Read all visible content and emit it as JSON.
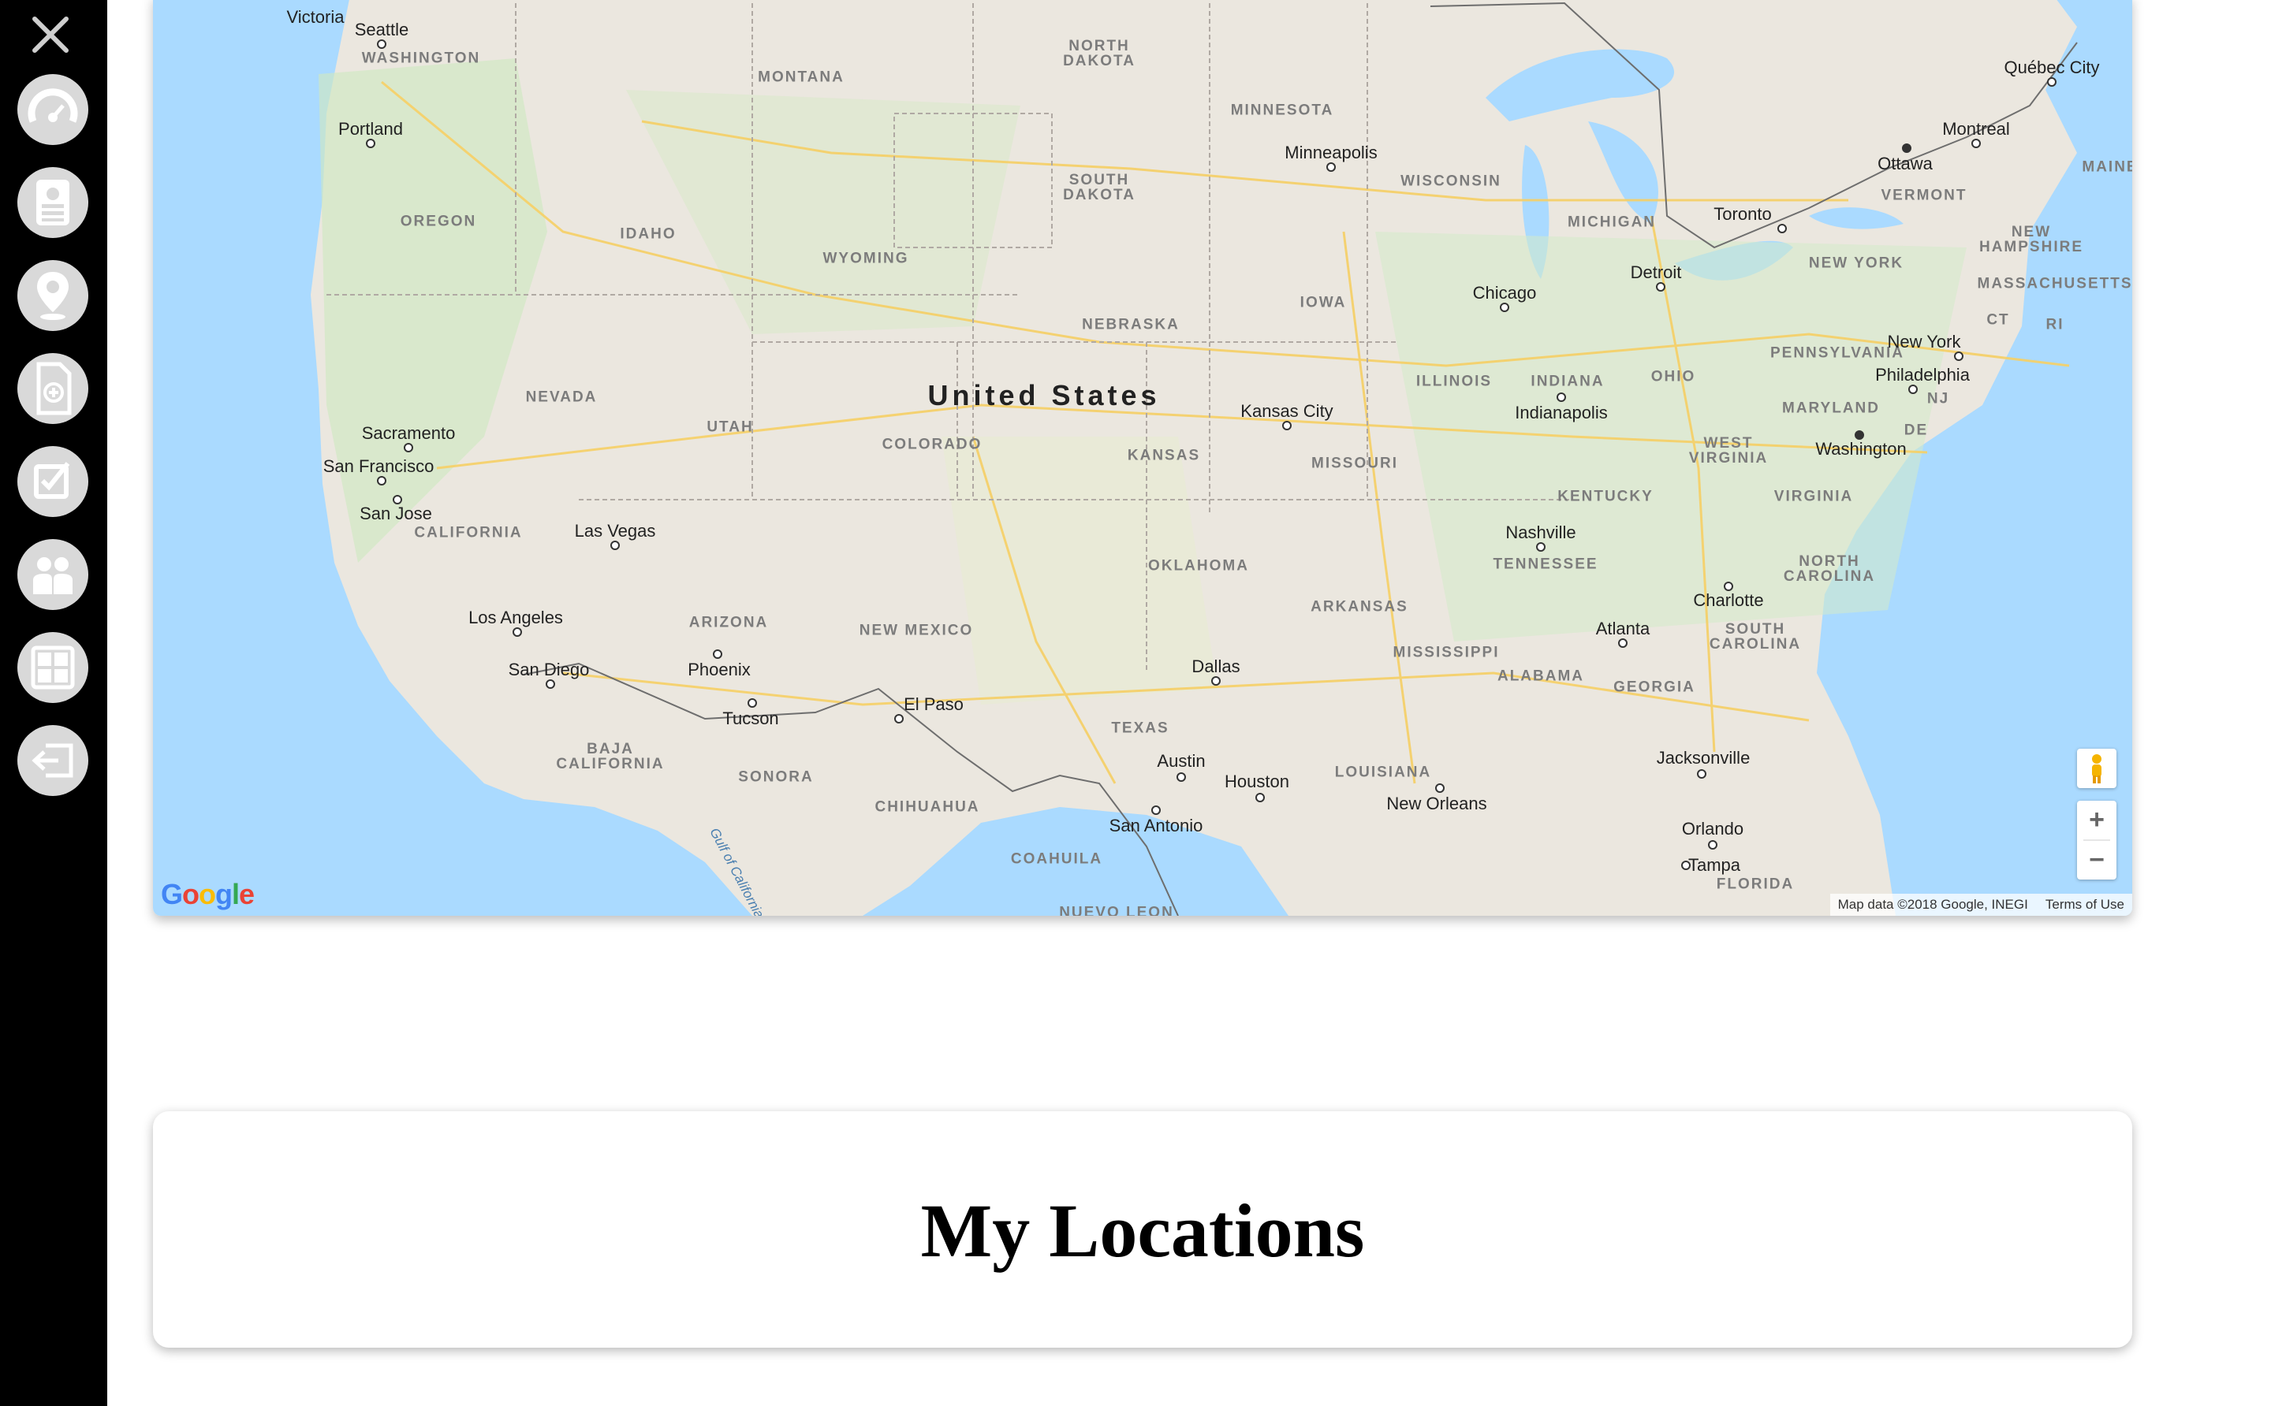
{
  "sidebar": {
    "close_icon": "close-icon",
    "items": [
      {
        "name": "dashboard",
        "icon": "speedometer-icon"
      },
      {
        "name": "profile",
        "icon": "id-card-icon"
      },
      {
        "name": "locations",
        "icon": "map-pin-icon"
      },
      {
        "name": "new-document",
        "icon": "document-plus-icon"
      },
      {
        "name": "tasks",
        "icon": "checklist-icon"
      },
      {
        "name": "team",
        "icon": "people-icon"
      },
      {
        "name": "calculator",
        "icon": "calculator-icon"
      },
      {
        "name": "logout",
        "icon": "logout-icon"
      }
    ],
    "colors": {
      "background": "#000000",
      "button": "#d9d9d9",
      "glyph": "#ffffff"
    }
  },
  "map": {
    "country_label": "United States",
    "state_labels": [
      "WASHINGTON",
      "MONTANA",
      "NORTH DAKOTA",
      "MINNESOTA",
      "OREGON",
      "IDAHO",
      "SOUTH DAKOTA",
      "WYOMING",
      "WISCONSIN",
      "MICHIGAN",
      "NEBRASKA",
      "IOWA",
      "NEVADA",
      "UTAH",
      "COLORADO",
      "KANSAS",
      "MISSOURI",
      "ILLINOIS",
      "INDIANA",
      "OHIO",
      "PENNSYLVANIA",
      "NEW YORK",
      "VERMONT",
      "MAINE",
      "NEW HAMPSHIRE",
      "MASSACHUSETTS",
      "CT",
      "RI",
      "NJ",
      "DE",
      "MARYLAND",
      "WEST VIRGINIA",
      "VIRGINIA",
      "KENTUCKY",
      "TENNESSEE",
      "NORTH CAROLINA",
      "SOUTH CAROLINA",
      "CALIFORNIA",
      "ARIZONA",
      "NEW MEXICO",
      "OKLAHOMA",
      "ARKANSAS",
      "MISSISSIPPI",
      "ALABAMA",
      "GEORGIA",
      "TEXAS",
      "LOUISIANA",
      "FLORIDA",
      "BAJA CALIFORNIA",
      "SONORA",
      "CHIHUAHUA",
      "COAHUILA",
      "NUEVO LEON"
    ],
    "city_labels": [
      "Victoria",
      "Seattle",
      "Portland",
      "Québec City",
      "Montreal",
      "Ottawa",
      "Minneapolis",
      "Toronto",
      "Detroit",
      "Chicago",
      "Sacramento",
      "San Francisco",
      "San Jose",
      "Kansas City",
      "Indianapolis",
      "New York",
      "Philadelphia",
      "Washington",
      "Las Vegas",
      "Nashville",
      "Los Angeles",
      "Charlotte",
      "San Diego",
      "Phoenix",
      "Atlanta",
      "Dallas",
      "Tucson",
      "El Paso",
      "Jacksonville",
      "Austin",
      "Houston",
      "New Orleans",
      "San Antonio",
      "Orlando",
      "Tampa"
    ],
    "water_label": "Gulf of California",
    "logo": "Google",
    "attribution": "Map data ©2018 Google, INEGI",
    "terms": "Terms of Use",
    "zoom_in": "+",
    "zoom_out": "−",
    "pegman_icon": "street-view-pegman-icon"
  },
  "locations_card": {
    "title": "My Locations"
  }
}
